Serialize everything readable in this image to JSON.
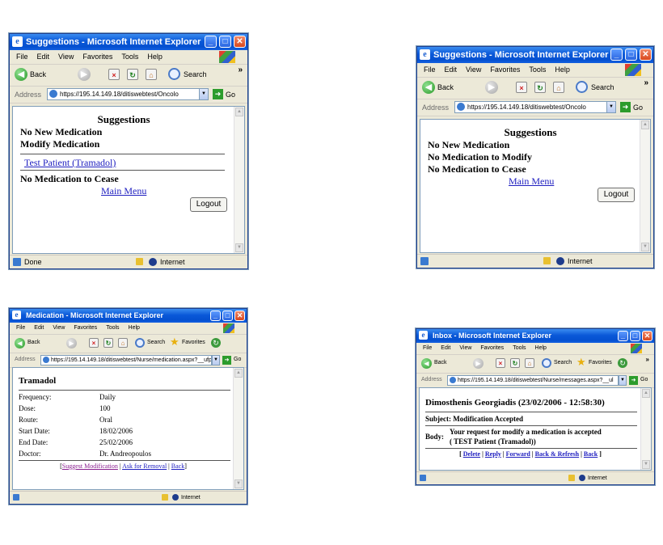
{
  "common": {
    "menu": [
      "File",
      "Edit",
      "View",
      "Favorites",
      "Tools",
      "Help"
    ],
    "back_label": "Back",
    "search_label": "Search",
    "favorites_label": "Favorites",
    "address_label": "Address",
    "go_label": "Go",
    "zone": "Internet",
    "done": "Done",
    "more": "»",
    "min_glyph": "_",
    "max_glyph": "□",
    "close_glyph": "✕"
  },
  "win1": {
    "title": "Suggestions - Microsoft Internet Explorer",
    "address": "https://195.14.149.18/ditiswebtest/Oncolo",
    "heading": "Suggestions",
    "line1": "No New Medication",
    "line2": "Modify Medication",
    "link": "Test Patient (Tramadol)",
    "line3": "No Medication to Cease",
    "main_menu": "Main Menu",
    "logout": "Logout"
  },
  "win2": {
    "title": "Suggestions - Microsoft Internet Explorer",
    "address": "https://195.14.149.18/ditiswebtest/Oncolo",
    "heading": "Suggestions",
    "line1": "No New Medication",
    "line2": "No Medication to Modify",
    "line3": "No Medication to Cease",
    "main_menu": "Main Menu",
    "logout": "Logout"
  },
  "win3": {
    "title": "Medication - Microsoft Internet Explorer",
    "address": "https://195.14.149.18/ditiswebtest/Nurse/medication.aspx?__ufp",
    "heading": "Tramadol",
    "rows": [
      {
        "label": "Frequency:",
        "value": "Daily"
      },
      {
        "label": "Dose:",
        "value": "100"
      },
      {
        "label": "Route:",
        "value": "Oral"
      },
      {
        "label": "Start Date:",
        "value": "18/02/2006"
      },
      {
        "label": "End Date:",
        "value": "25/02/2006"
      },
      {
        "label": "Doctor:",
        "value": "Dr. Andreopoulos"
      }
    ],
    "bracket_open": "[",
    "bracket_close": "]",
    "sep": "|",
    "links": [
      "Suggest Modification",
      "Ask for Removal",
      "Back"
    ]
  },
  "win4": {
    "title": "Inbox - Microsoft Internet Explorer",
    "address": "https://195.14.149.18/ditiswebtest/Nurse/messages.aspx?__ul",
    "heading": "Dimosthenis Georgiadis (23/02/2006 - 12:58:30)",
    "subject_label": "Subject:",
    "subject": "Modification Accepted",
    "body_label": "Body:",
    "body_line1": "Your request for modify a medication is accepted",
    "body_line2": "( TEST Patient (Tramadol))",
    "bracket_open": "[",
    "bracket_close": "]",
    "sep": "|",
    "links": [
      "Delete",
      "Reply",
      "Forward",
      "Back & Refresh",
      "Back"
    ]
  }
}
